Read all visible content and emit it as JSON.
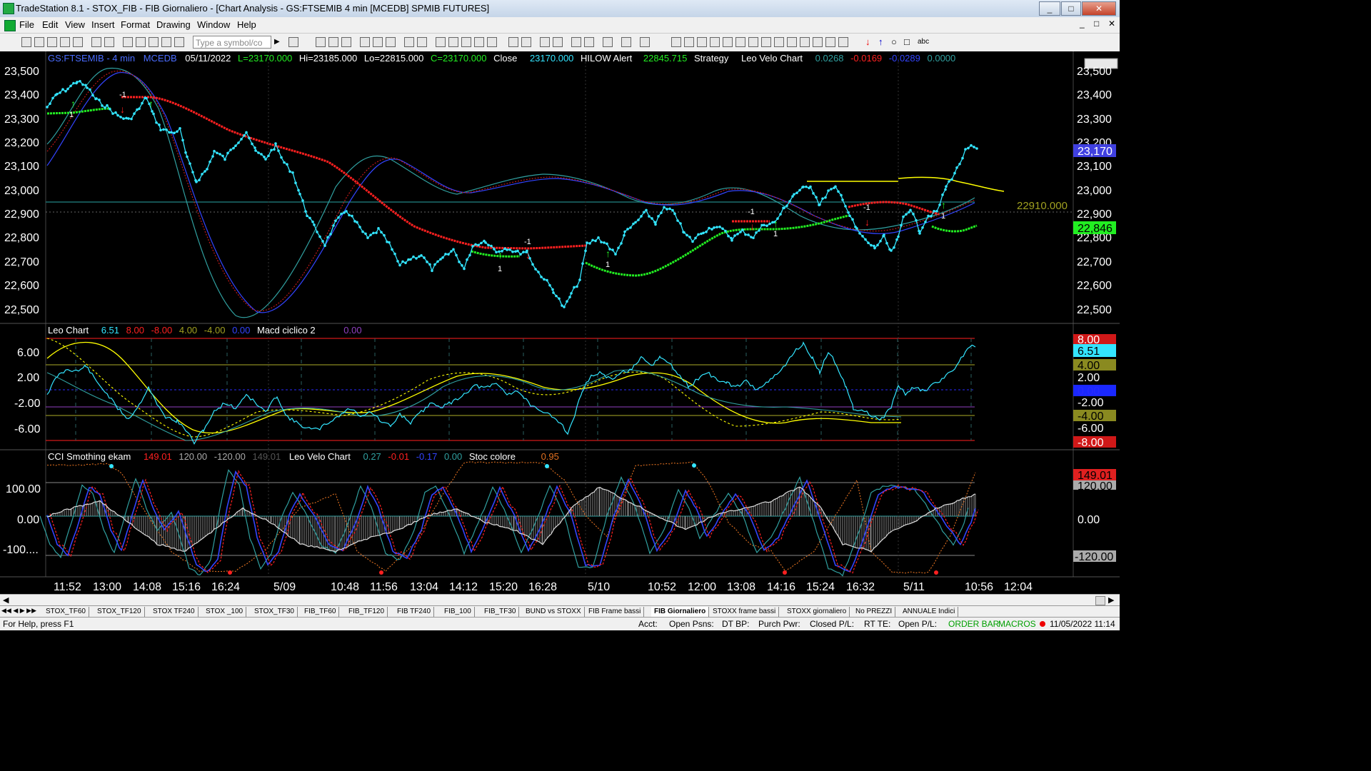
{
  "window": {
    "title": "TradeStation 8.1 - STOX_FIB - FIB Giornaliero - [Chart Analysis - GS:FTSEMIB  4 min  [MCEDB] SPMIB FUTURES]",
    "controls": [
      "_",
      "□",
      "✕"
    ]
  },
  "menu": [
    "File",
    "Edit",
    "View",
    "Insert",
    "Format",
    "Drawing",
    "Window",
    "Help"
  ],
  "mdi_controls": [
    "_",
    "□",
    "✕"
  ],
  "toolbar": {
    "symbol_placeholder": "Type a symbol/co",
    "abc_label": "abc"
  },
  "chart": {
    "header": {
      "symbol": "GS:FTSEMIB - 4 min",
      "exchange": "MCEDB",
      "date": "05/11/2022",
      "last": "L=23170.000",
      "high": "Hi=23185.000",
      "low": "Lo=22815.000",
      "close": "C=23170.000",
      "close_label": "Close",
      "close_value": "23170.000",
      "hilow_label": "HILOW Alert",
      "hilow_value": "22845.715",
      "strategy_label": "Strategy",
      "leo_label": "Leo Velo Chart",
      "leo_v1": "0.0268",
      "leo_v2": "-0.0169",
      "leo_v3": "-0.0289",
      "leo_v4": "0.0000"
    },
    "price_ticks": [
      "23,500",
      "23,400",
      "23,300",
      "23,200",
      "23,100",
      "23,000",
      "22,900",
      "22,800",
      "22,700",
      "22,600",
      "22,500"
    ],
    "price_right_ticks": [
      "23,500",
      "23,400",
      "23,300",
      "23,200",
      "23,100",
      "23,000",
      "22,900",
      "22,800",
      "22,700",
      "22,600",
      "22,500"
    ],
    "price_badge_last": "23,170",
    "price_badge_hilow": "22,846",
    "hline_label": "22910.000",
    "signals": {
      "minus1": "-1",
      "plus1": "1"
    },
    "osc1": {
      "title": "Leo Chart",
      "v1": "6.51",
      "v2": "8.00",
      "v3": "-8.00",
      "v4": "4.00",
      "v5": "-4.00",
      "v6": "0.00",
      "macd_label": "Macd ciclico 2",
      "macd_value": "0.00",
      "ticks": [
        "6.00",
        "2.00",
        "-2.00",
        "-6.00"
      ],
      "badges": [
        "8.00",
        "6.51",
        "4.00",
        "2.00",
        "0.00",
        "-2.00",
        "-4.00",
        "-6.00",
        "-8.00"
      ]
    },
    "osc2": {
      "title": "CCI Smothing ekam",
      "v1": "149.01",
      "v2": "120.00",
      "v3": "-120.00",
      "v4": "149.01",
      "leo_label": "Leo Velo Chart",
      "leo_v1": "0.27",
      "leo_v2": "-0.01",
      "leo_v3": "-0.17",
      "leo_v4": "0.00",
      "stoc_label": "Stoc colore",
      "stoc_value": "0.95",
      "ticks": [
        "100.00",
        "0.00",
        "-100...."
      ],
      "badges": [
        "149.01",
        "120.00",
        "0.00",
        "-120.00"
      ]
    },
    "time_ticks": [
      "11:52",
      "13:00",
      "14:08",
      "15:16",
      "16:24",
      "5/09",
      "10:48",
      "11:56",
      "13:04",
      "14:12",
      "15:20",
      "16:28",
      "5/10",
      "10:52",
      "12:00",
      "13:08",
      "14:16",
      "15:24",
      "16:32",
      "5/11",
      "10:56",
      "12:04"
    ],
    "colors": {
      "price": "#33e5ff",
      "red_line": "#ff2020",
      "green_line": "#22ee22",
      "yellow": "#ffff00",
      "blue": "#3344ff",
      "teal": "#30a0a0",
      "dkred": "#c01818"
    }
  },
  "tabs": [
    "STOX_TF60",
    "STOX_TF120",
    "STOX TF240",
    "STOX _100",
    "STOX_TF30",
    "FIB_TF60",
    "FIB_TF120",
    "FIB TF240",
    "FIB_100",
    "FIB_TF30",
    "BUND vs STOXX",
    "FIB Frame bassi",
    "FIB Giornaliero",
    "STOXX frame bassi",
    "STOXX giornaliero",
    "No PREZZI",
    "ANNUALE Indici"
  ],
  "active_tab": "FIB Giornaliero",
  "status": {
    "help": "For Help, press F1",
    "acct": "Acct:",
    "open_psns": "Open Psns:",
    "dt_bp": "DT BP:",
    "purch_pwr": "Purch Pwr:",
    "closed_pl": "Closed P/L:",
    "rt_te": "RT TE:",
    "open_pl": "Open P/L:",
    "order_bar": "ORDER BAR",
    "macros": "MACROS",
    "datetime": "11/05/2022 11:14"
  }
}
